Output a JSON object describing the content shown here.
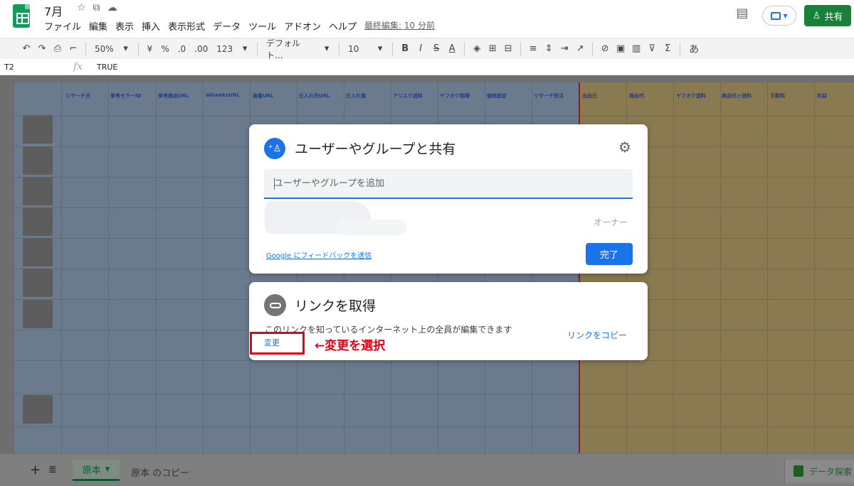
{
  "header": {
    "doc_title": "7月",
    "menu": [
      "ファイル",
      "編集",
      "表示",
      "挿入",
      "表示形式",
      "データ",
      "ツール",
      "アドオン",
      "ヘルプ"
    ],
    "last_edit": "最終編集: 10 分前",
    "share_label": "共有"
  },
  "toolbar": {
    "zoom": "50%",
    "currency": "¥",
    "percent": "%",
    "decimal_dec": ".0",
    "decimal_inc": ".00",
    "number_format": "123",
    "font": "デフォルト...",
    "font_size": "10",
    "input_tool": "あ"
  },
  "formula_bar": {
    "cell_ref": "T2",
    "fx_label": "fx",
    "value": "TRUE"
  },
  "sheet": {
    "headers": [
      "リサーチ日",
      "参考セラーID",
      "参考商品URL",
      "aliseeksURL",
      "画像URL",
      "仕入れ先URL",
      "仕入れ値",
      "アリエク送料",
      "ヤフオク相場",
      "価格設定",
      "リサーチ担当",
      "出品日",
      "商品代",
      "ヤフオク送料",
      "商品代＋送料",
      "手数料",
      "利益"
    ]
  },
  "bottom_bar": {
    "tab_active": "原本",
    "tab_copy": "原本 のコピー",
    "explore_label": "データ探索"
  },
  "share_dialog": {
    "title": "ユーザーやグループと共有",
    "add_placeholder": "ユーザーやグループを追加",
    "owner_role": "オーナー",
    "feedback_label": "Google にフィードバックを送信",
    "done_label": "完了"
  },
  "link_dialog": {
    "title": "リンクを取得",
    "description": "このリンクを知っているインターネット上の全員が編集できます",
    "change_label": "変更",
    "copy_label": "リンクをコピー"
  },
  "annotation": {
    "text": "←変更を選択",
    "color": "#e60012"
  },
  "colors": {
    "accent": "#1a73e8",
    "share_button": "#188038"
  }
}
